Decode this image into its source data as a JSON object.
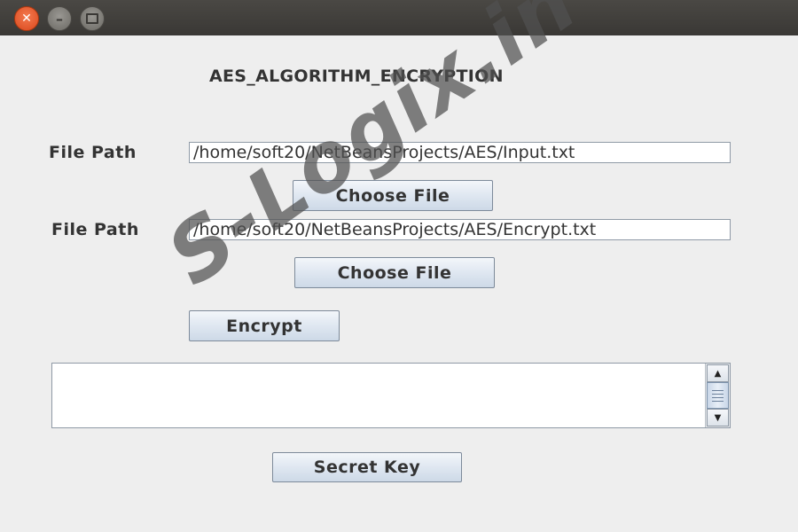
{
  "window": {
    "controls": {
      "close_icon": "close-icon",
      "minimize_icon": "minimize-icon",
      "maximize_icon": "maximize-icon"
    }
  },
  "app": {
    "title": "AES_ALGORITHM_ENCRYPTION"
  },
  "form": {
    "input_row": {
      "label": "File Path",
      "value": "/home/soft20/NetBeansProjects/AES/Input.txt",
      "button_label": "Choose File"
    },
    "output_row": {
      "label": "File Path",
      "value": "/home/soft20/NetBeansProjects/AES/Encrypt.txt",
      "button_label": "Choose File"
    },
    "encrypt_button_label": "Encrypt",
    "output_text": "",
    "secret_key_button_label": "Secret Key"
  },
  "watermark": {
    "text": "S-Logix.in"
  },
  "colors": {
    "close_button": "#e9541d",
    "titlebar": "#3f3d39",
    "button_gradient": "#dfe7f1"
  }
}
